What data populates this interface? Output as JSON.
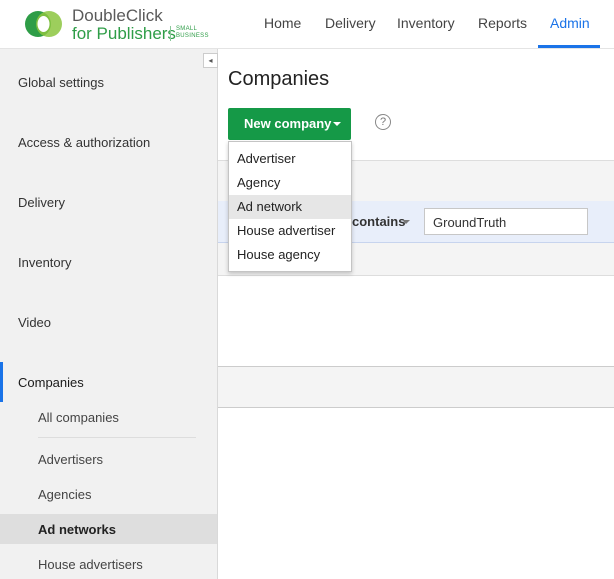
{
  "brand": {
    "line1": "DoubleClick",
    "line2": "for Publishers",
    "tag_line1": "SMALL",
    "tag_line2": "BUSINESS",
    "colors": {
      "green": "#2e9d47",
      "dark_green": "#159947",
      "blue": "#1a73e8"
    }
  },
  "nav": {
    "items": [
      {
        "label": "Home",
        "active": false
      },
      {
        "label": "Delivery",
        "active": false
      },
      {
        "label": "Inventory",
        "active": false
      },
      {
        "label": "Reports",
        "active": false
      },
      {
        "label": "Admin",
        "active": true
      }
    ]
  },
  "sidebar": {
    "collapse_icon": "◂",
    "items": [
      "Global settings",
      "Access & authorization",
      "Delivery",
      "Inventory",
      "Video",
      "Companies"
    ],
    "active_item": "Companies",
    "subitems": [
      "All companies",
      "Advertisers",
      "Agencies",
      "Ad networks",
      "House advertisers"
    ],
    "active_subitem": "Ad networks"
  },
  "main": {
    "title": "Companies",
    "new_button_label": "New company",
    "help_icon": "?",
    "filter": {
      "operator": "contains",
      "value": "GroundTruth"
    },
    "dropdown": {
      "items": [
        "Advertiser",
        "Agency",
        "Ad network",
        "House advertiser",
        "House agency"
      ],
      "highlighted": "Ad network"
    }
  }
}
